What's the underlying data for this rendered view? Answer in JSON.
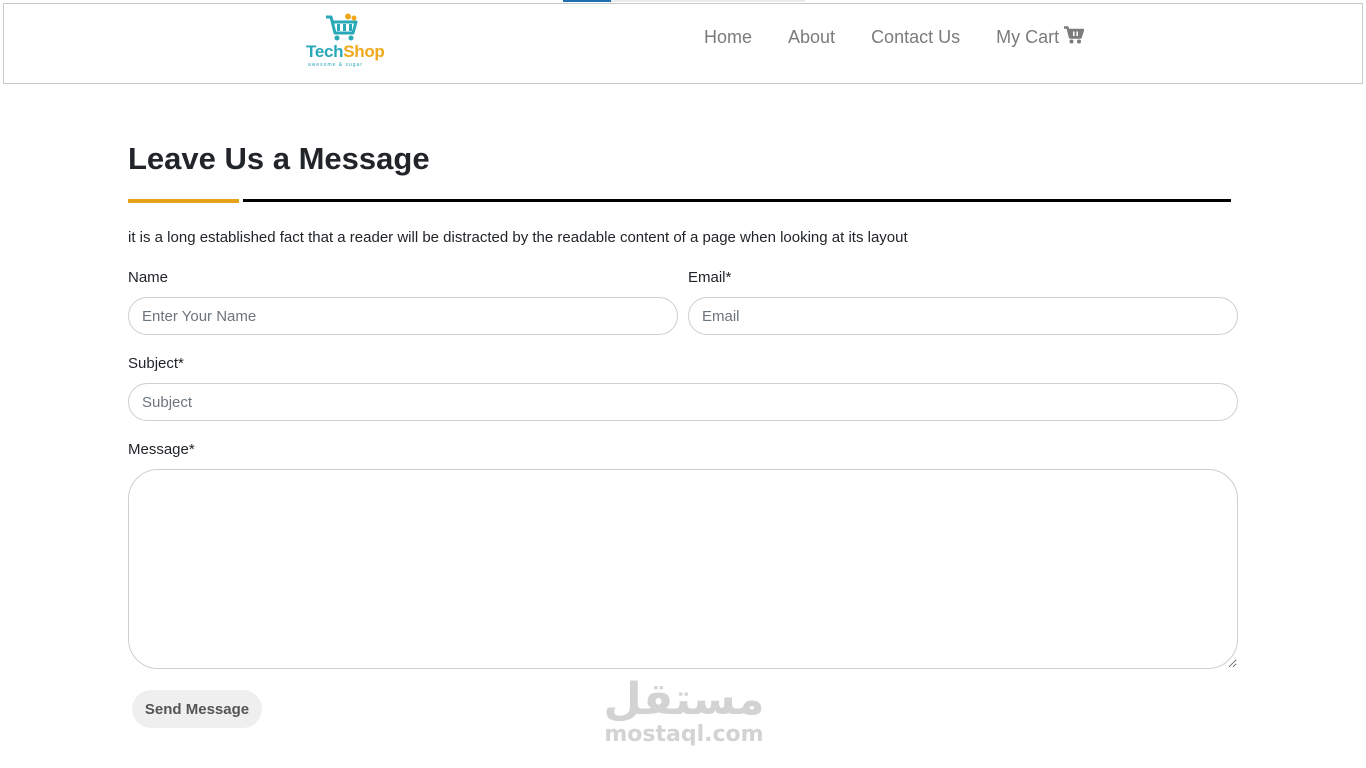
{
  "brand": {
    "name_part1": "Tech",
    "name_part2": "Shop",
    "tagline": "awesome & sugar",
    "colors": {
      "teal": "#29a8b8",
      "orange": "#f0a81c"
    }
  },
  "nav": {
    "items": [
      {
        "label": "Home"
      },
      {
        "label": "About"
      },
      {
        "label": "Contact Us"
      },
      {
        "label": "My Cart",
        "icon": "cart-icon"
      }
    ]
  },
  "contact": {
    "heading": "Leave Us a Message",
    "intro": "it is a long established fact that a reader will be distracted by the readable content of a page when looking at its layout",
    "fields": {
      "name": {
        "label": "Name",
        "placeholder": "Enter Your Name",
        "value": ""
      },
      "email": {
        "label": "Email*",
        "placeholder": "Email",
        "value": ""
      },
      "subject": {
        "label": "Subject*",
        "placeholder": "Subject",
        "value": ""
      },
      "message": {
        "label": "Message*",
        "placeholder": "",
        "value": ""
      }
    },
    "submit_label": "Send Message",
    "accent_color": "#e5a31a"
  },
  "watermark": {
    "arabic": "مستقل",
    "latin": "mostaql.com"
  }
}
